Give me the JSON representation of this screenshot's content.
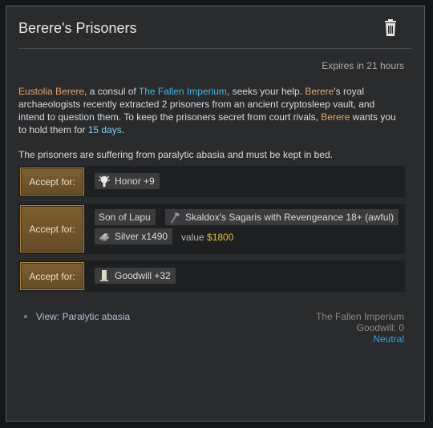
{
  "quest": {
    "title": "Berere's Prisoners",
    "expires": "Expires in 21 hours",
    "desc": {
      "leader": "Eustolia Berere",
      "t1": ", a consul of ",
      "faction": "The Fallen Imperium",
      "t2": ", seeks your help. ",
      "name1": "Berere",
      "t3": "'s royal archaeologists recently extracted 2 prisoners from an ancient cryptosleep vault, and intend to question them. To keep the prisoners secret from court rivals, ",
      "name2": "Berere",
      "t4": " wants you to hold them for ",
      "days": "15 days",
      "t5": ".",
      "p2": "The prisoners are suffering from paralytic abasia and must be kept in bed."
    }
  },
  "options": [
    {
      "button": "Accept for:",
      "rewards": [
        {
          "icon": "honor-icon",
          "label": "Honor +9"
        }
      ]
    },
    {
      "button": "Accept for:",
      "rewards": [
        {
          "icon": "",
          "label": "Son of Lapu"
        },
        {
          "icon": "sagaris-icon",
          "label": "Skaldox's Sagaris with Revengeance 18+ (awful)"
        },
        {
          "icon": "silver-icon",
          "label": "Silver x1490"
        }
      ],
      "value_label": "value",
      "value_amount": "$1800"
    },
    {
      "button": "Accept for:",
      "rewards": [
        {
          "icon": "goodwill-icon",
          "label": "Goodwill +32"
        }
      ]
    }
  ],
  "view_link": "View: Paralytic abasia",
  "faction_info": {
    "name": "The Fallen Imperium",
    "goodwill": "Goodwill: 0",
    "status": "Neutral"
  },
  "colors": {
    "leader": "#e0a462",
    "faction": "#3fb9e6",
    "days": "#7fd1e6",
    "value": "#e0c22f",
    "neutral": "#2ea7dd",
    "button": "#7d6032"
  }
}
